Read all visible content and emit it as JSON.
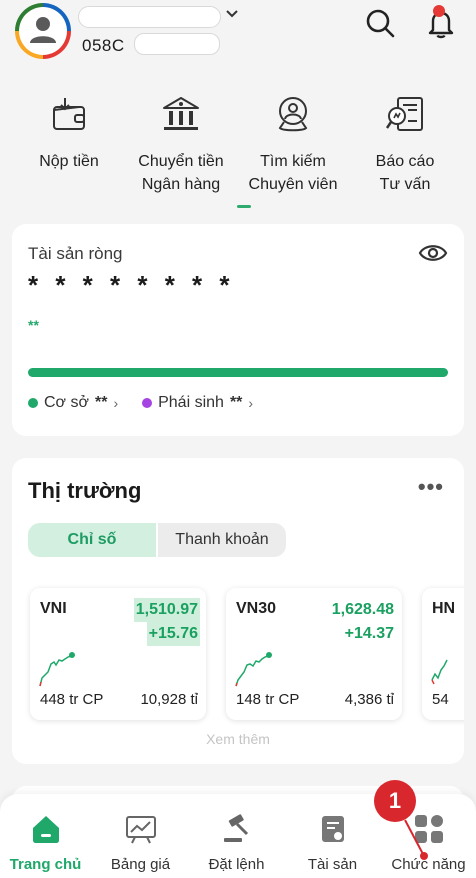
{
  "header": {
    "account_prefix": "058C",
    "icons": [
      "user-avatar-icon",
      "chevron-down-icon",
      "search-icon",
      "bell-icon"
    ]
  },
  "quick_actions": [
    {
      "label": "Nộp tiền",
      "icon": "wallet-deposit-icon"
    },
    {
      "label": "Chuyển tiền\nNgân hàng",
      "icon": "bank-icon"
    },
    {
      "label": "Tìm kiếm\nChuyên viên",
      "icon": "search-advisor-icon"
    },
    {
      "label": "Báo cáo\nTư vấn",
      "icon": "report-icon"
    }
  ],
  "net_worth": {
    "title": "Tài sản ròng",
    "masked_value": "* * * * * * * *",
    "masked_change": "**",
    "legend": [
      {
        "label": "Cơ sở",
        "value": "**",
        "color": "#1fa86a"
      },
      {
        "label": "Phái sinh",
        "value": "**",
        "color": "#a544e3"
      }
    ]
  },
  "market": {
    "title": "Thị trường",
    "more": "•••",
    "tabs": {
      "active": "Chỉ số",
      "inactive": "Thanh khoản"
    },
    "indices": [
      {
        "name": "VNI",
        "price": "1,510.97",
        "change": "+15.76",
        "volume": "448 tr CP",
        "value": "10,928 tỉ"
      },
      {
        "name": "VN30",
        "price": "1,628.48",
        "change": "+14.37",
        "volume": "148 tr CP",
        "value": "4,386 tỉ"
      },
      {
        "name": "HN",
        "volume": "54"
      }
    ],
    "see_more": "Xem thêm"
  },
  "bottom_nav": [
    {
      "label": "Trang chủ",
      "icon": "home-icon",
      "active": true
    },
    {
      "label": "Bảng giá",
      "icon": "price-board-icon",
      "active": false
    },
    {
      "label": "Đặt lệnh",
      "icon": "gavel-order-icon",
      "active": false
    },
    {
      "label": "Tài sản",
      "icon": "assets-icon",
      "active": false
    },
    {
      "label": "Chức năng",
      "icon": "grid-functions-icon",
      "active": false
    }
  ],
  "annotation": {
    "badge": "1",
    "color": "#d9272e"
  }
}
